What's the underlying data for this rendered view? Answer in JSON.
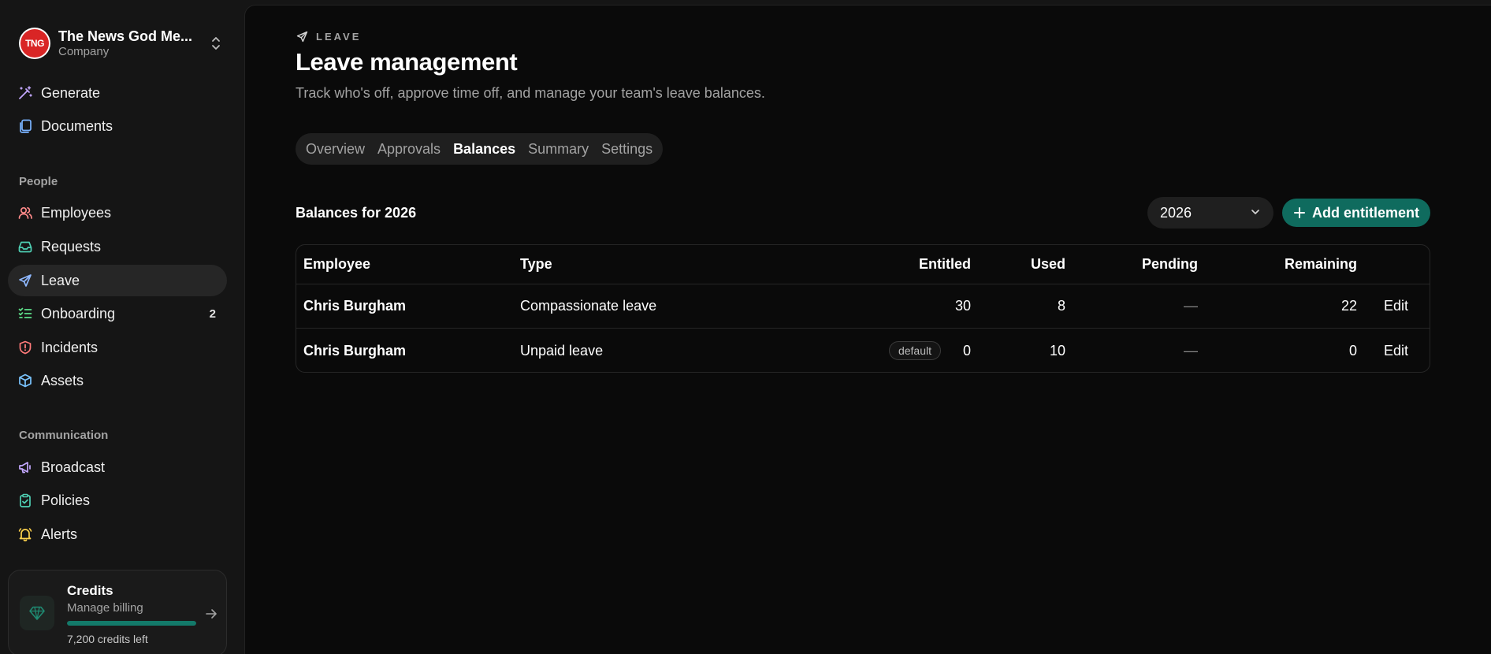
{
  "org": {
    "name": "The News God Me...",
    "subtitle": "Company",
    "logo_text": "TNG"
  },
  "nav": {
    "top": [
      {
        "label": "Generate",
        "icon": "wand-icon"
      },
      {
        "label": "Documents",
        "icon": "documents-icon"
      }
    ],
    "people_label": "People",
    "people": [
      {
        "label": "Employees",
        "icon": "users-icon"
      },
      {
        "label": "Requests",
        "icon": "inbox-icon"
      },
      {
        "label": "Leave",
        "icon": "plane-icon",
        "active": true
      },
      {
        "label": "Onboarding",
        "icon": "checklist-icon",
        "badge": "2"
      },
      {
        "label": "Incidents",
        "icon": "shield-alert-icon"
      },
      {
        "label": "Assets",
        "icon": "box-icon"
      }
    ],
    "communication_label": "Communication",
    "communication": [
      {
        "label": "Broadcast",
        "icon": "megaphone-icon"
      },
      {
        "label": "Policies",
        "icon": "clipboard-check-icon"
      },
      {
        "label": "Alerts",
        "icon": "bell-icon"
      }
    ]
  },
  "credits": {
    "title": "Credits",
    "subtitle": "Manage billing",
    "remaining_label": "7,200 credits left",
    "progress": 1.0
  },
  "page": {
    "eyebrow": "LEAVE",
    "title": "Leave management",
    "subtitle": "Track who's off, approve time off, and manage your team's leave balances."
  },
  "tabs": [
    {
      "label": "Overview"
    },
    {
      "label": "Approvals"
    },
    {
      "label": "Balances",
      "active": true
    },
    {
      "label": "Summary"
    },
    {
      "label": "Settings"
    }
  ],
  "balances": {
    "heading": "Balances for 2026",
    "year": "2026",
    "add_label": "Add entitlement",
    "columns": {
      "employee": "Employee",
      "type": "Type",
      "entitled": "Entitled",
      "used": "Used",
      "pending": "Pending",
      "remaining": "Remaining"
    },
    "rows": [
      {
        "employee": "Chris Burgham",
        "type": "Compassionate leave",
        "entitled": "30",
        "used": "8",
        "pending": "—",
        "remaining": "22",
        "action": "Edit"
      },
      {
        "employee": "Chris Burgham",
        "type": "Unpaid leave",
        "badge": "default",
        "entitled": "0",
        "used": "10",
        "pending": "—",
        "remaining": "0",
        "action": "Edit"
      }
    ]
  },
  "colors": {
    "accent": "#0f6b5e",
    "background": "#0a0a0a",
    "sidebar": "#151515"
  }
}
